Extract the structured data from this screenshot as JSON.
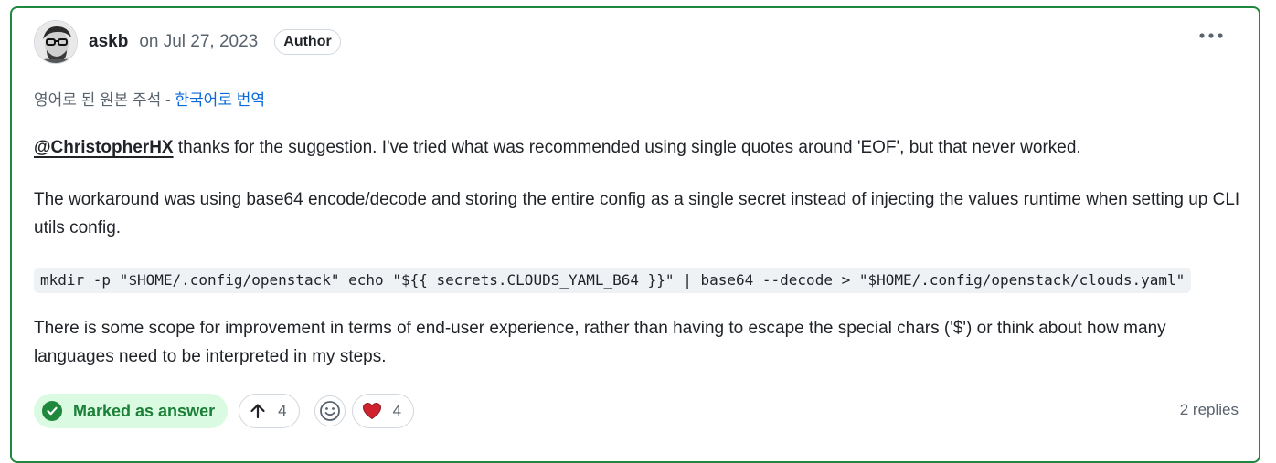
{
  "comment": {
    "author": "askb",
    "date": "on Jul 27, 2023",
    "badge": "Author",
    "more_icon": "kebab-horizontal-icon",
    "translation": {
      "prefix": "영어로 된 원본 주석 - ",
      "link": "한국어로 번역"
    },
    "mention": "@ChristopherHX",
    "paragraph1_rest": " thanks for the suggestion. I've tried what was recommended using single quotes around 'EOF', but that never worked.",
    "paragraph2": "The workaround was using base64 encode/decode and storing the entire config as a single secret instead of injecting the values runtime when setting up CLI utils config.",
    "code": "mkdir -p \"$HOME/.config/openstack\" echo \"${{ secrets.CLOUDS_YAML_B64 }}\" | base64 --decode > \"$HOME/.config/openstack/clouds.yaml\"",
    "paragraph3": "There is some scope for improvement in terms of end-user experience, rather than having to escape the special chars ('$') or think about how many languages need to be interpreted in my steps."
  },
  "footer": {
    "answer_label": "Marked as answer",
    "upvote_count": "4",
    "heart_count": "4",
    "replies": "2 replies"
  },
  "colors": {
    "accent_border": "#1f883d",
    "answer_bg": "#dafbe1",
    "answer_text": "#1a7f37",
    "link": "#0969da",
    "muted": "#59636e",
    "heart": "#cf222e"
  }
}
